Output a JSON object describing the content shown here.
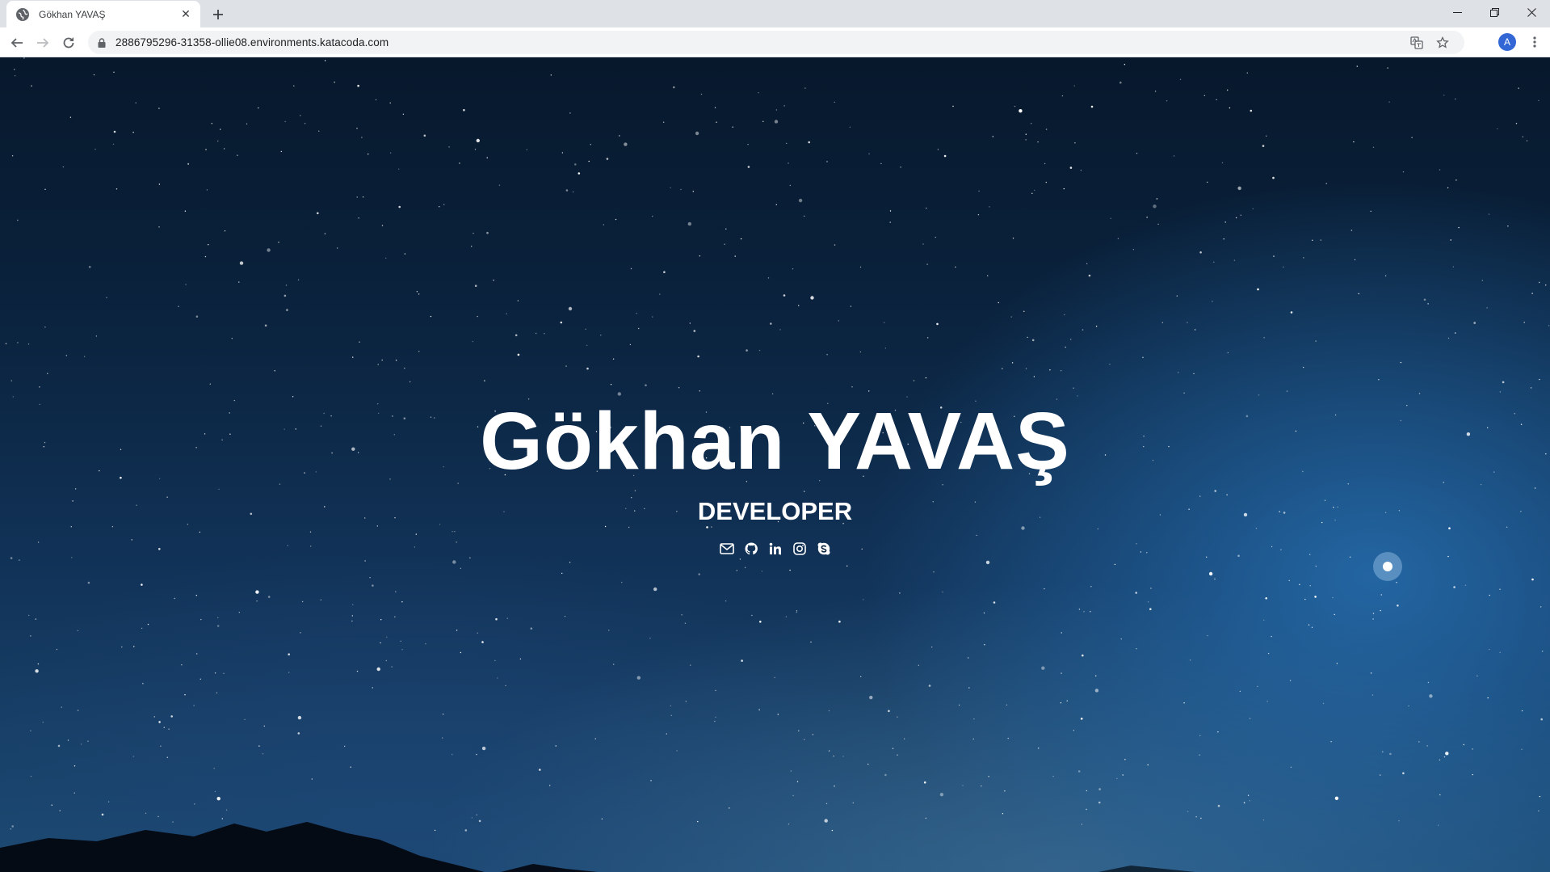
{
  "browser": {
    "tab": {
      "title": "Gökhan YAVAŞ",
      "close_glyph": "✕",
      "favicon": "globe-icon"
    },
    "new_tab_icon": "plus-icon",
    "address_bar": {
      "url": "2886795296-31358-ollie08.environments.katacoda.com",
      "secure_icon": "lock-icon"
    },
    "profile_initial": "A",
    "window_controls": [
      "minimize-icon",
      "restore-icon",
      "close-icon"
    ],
    "toolbar_icons": [
      "back-icon",
      "forward-icon",
      "reload-icon",
      "translate-icon",
      "bookmark-star-icon",
      "kebab-menu-icon"
    ]
  },
  "page": {
    "name": "Gökhan YAVAŞ",
    "role": "DEVELOPER",
    "social_links": [
      "envelope-icon",
      "github-icon",
      "linkedin-icon",
      "instagram-icon",
      "skype-icon"
    ],
    "background": "starry night sky"
  },
  "colors": {
    "chrome_bg": "#dee1e6",
    "toolbar_bg": "#ffffff",
    "avatar": "#3367d6",
    "text_white": "#ffffff"
  }
}
